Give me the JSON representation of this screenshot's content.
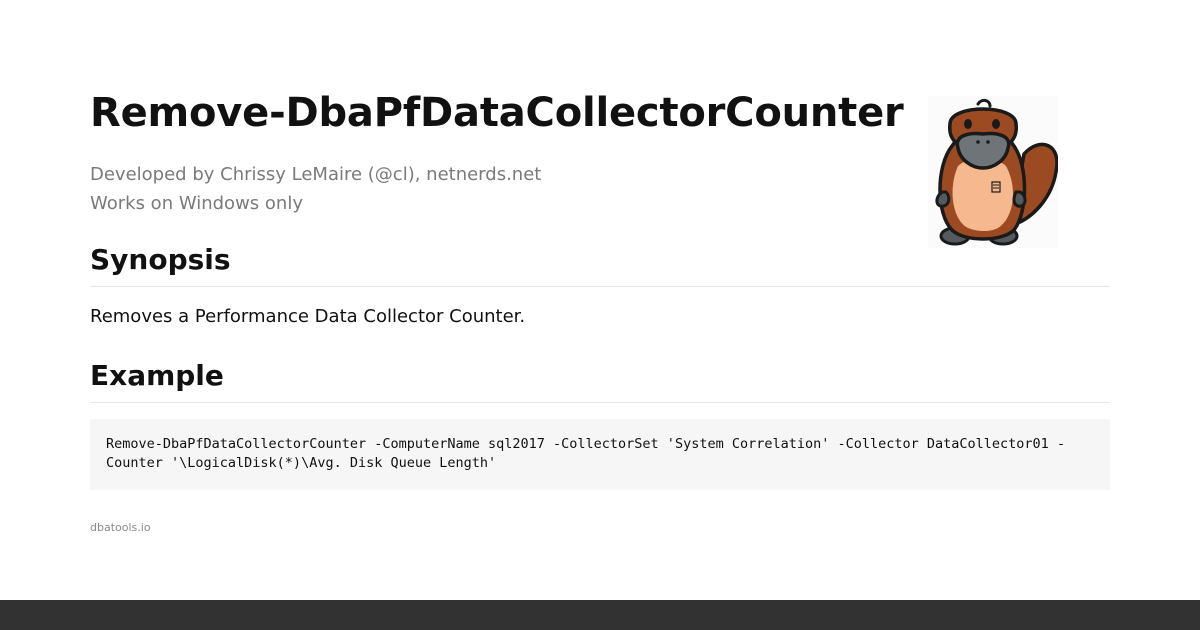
{
  "header": {
    "title": "Remove-DbaPfDataCollectorCounter",
    "author_line": "Developed by Chrissy LeMaire (@cl), netnerds.net",
    "platform_line": "Works on Windows only"
  },
  "synopsis": {
    "heading": "Synopsis",
    "text": "Removes a Performance Data Collector Counter."
  },
  "example": {
    "heading": "Example",
    "code": "Remove-DbaPfDataCollectorCounter -ComputerName sql2017 -CollectorSet 'System Correlation' -Collector DataCollector01 -Counter '\\LogicalDisk(*)\\Avg. Disk Queue Length'"
  },
  "footer": {
    "site": "dbatools.io"
  },
  "mascot": {
    "icon": "platypus-mascot-icon"
  },
  "colors": {
    "background": "#ffffff",
    "title": "#111111",
    "meta_text": "#7a7a7a",
    "code_background": "#f6f6f6",
    "bottom_bar": "#323232"
  }
}
